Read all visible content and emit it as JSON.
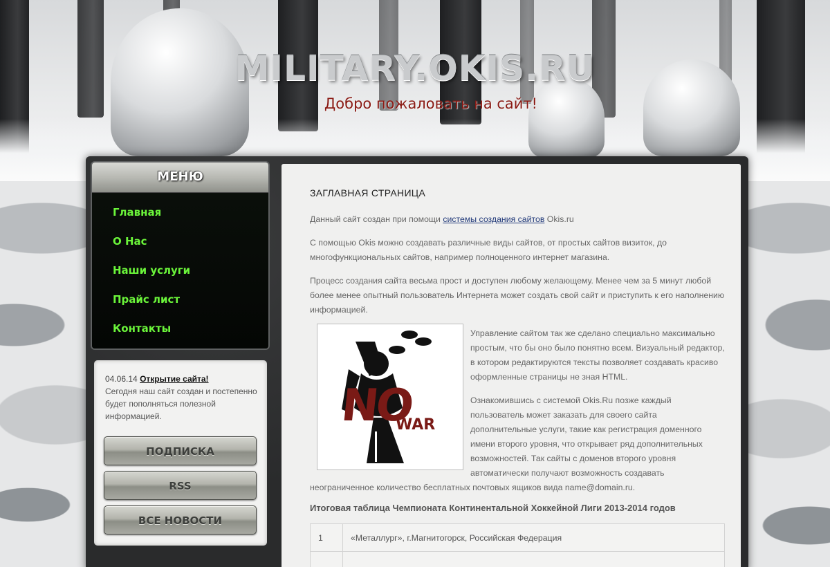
{
  "header": {
    "site_title": "MILITARY.OKIS.RU",
    "subtitle": "Добро пожаловать на сайт!"
  },
  "sidebar": {
    "menu_title": "МЕНЮ",
    "menu_items": [
      {
        "label": "Главная"
      },
      {
        "label": "О Нас"
      },
      {
        "label": "Наши услуги"
      },
      {
        "label": "Прайс лист"
      },
      {
        "label": "Контакты"
      }
    ],
    "news": {
      "date": "04.06.14",
      "title": "Открытие сайта!",
      "text": "Сегодня наш сайт создан и постепенно будет пополняться полезной информацией."
    },
    "buttons": {
      "subscribe": "ПОДПИСКА",
      "rss": "RSS",
      "all_news": "ВСЕ НОВОСТИ"
    }
  },
  "main": {
    "page_title": "ЗАГЛАВНАЯ СТРАНИЦА",
    "p1_before": "Данный сайт создан при помощи ",
    "p1_link": "системы создания сайтов",
    "p1_after": " Okis.ru",
    "p2": "С помощью Okis можно создавать различные виды сайтов, от простых сайтов визиток, до многофункциональных сайтов, например полноценного интернет магазина.",
    "p3": "Процесс создания сайта весьма прост и доступен любому желающему. Менее чем за 5 минут любой более менее опытный пользователь Интернета может создать свой сайт и приступить к его наполнению информацией.",
    "p4": "Управление сайтом так же сделано специально максимально простым, что бы оно было понятно всем. Визуальный редактор, в котором редактируются тексты позволяет создавать красиво оформленные страницы не зная HTML.",
    "p5": "Ознакомившись с системой Okis.Ru позже каждый пользователь может заказать для своего сайта дополнительные услуги, такие как регистрация доменного имени второго уровня, что открывает ряд дополнительных возможностей. Так сайты с доменов второго уровня автоматически получают возможность создавать неограниченное количество бесплатных почтовых ящиков вида name@domain.ru.",
    "poster": {
      "no": "NO",
      "war": "WAR"
    },
    "table_title": "Итоговая таблица Чемпионата Континентальной Хоккейной Лиги 2013-2014 годов",
    "table_rows": [
      {
        "num": "1",
        "team": "«Металлург», г.Магнитогорск, Российская Федерация"
      },
      {
        "num": "",
        "team": ""
      }
    ]
  }
}
